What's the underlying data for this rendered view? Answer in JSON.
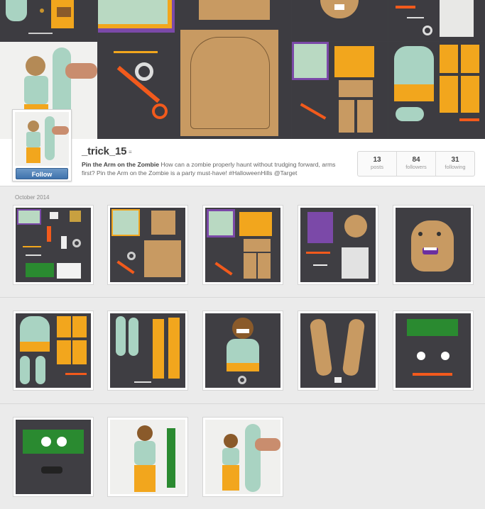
{
  "profile": {
    "username": "_trick_15",
    "verified_mark": "≡",
    "follow_label": "Follow",
    "bio_title": "Pin the Arm on the Zombie",
    "bio_text": " How can a zombie properly haunt without trudging forward, arms first? Pin the Arm on the Zombie is a party must-have! #HalloweenHills @Target"
  },
  "stats": [
    {
      "value": "13",
      "label": "posts"
    },
    {
      "value": "84",
      "label": "followers"
    },
    {
      "value": "31",
      "label": "following"
    }
  ],
  "feed": {
    "section_date": "October 2014"
  },
  "colors": {
    "board": "#3d3c41",
    "zombie_skin": "#a9d3c2",
    "pants": "#f2a61d",
    "cardboard": "#c89a62",
    "scissors": "#f25a1c",
    "felt_green": "#2a8a30"
  }
}
